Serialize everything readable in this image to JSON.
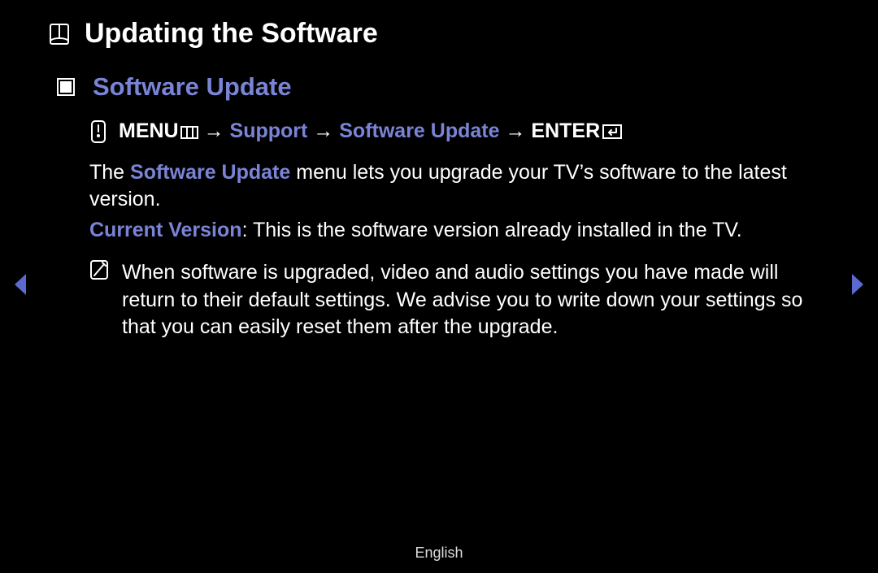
{
  "page": {
    "title": "Updating the Software"
  },
  "section": {
    "title": "Software Update"
  },
  "navPath": {
    "menu": "MENU",
    "arrow1": " → ",
    "support": "Support",
    "arrow2": " → ",
    "softwareUpdate": "Software Update",
    "arrow3": " → ",
    "enter": "ENTER"
  },
  "description": {
    "pre": "The ",
    "em": "Software Update",
    "post": " menu lets you upgrade your TV’s software to the latest version."
  },
  "currentVersion": {
    "label": "Current Version",
    "text": ": This is the software version already installed in the TV."
  },
  "note": {
    "text": "When software is upgraded, video and audio settings you have made will return to their default settings. We advise you to write down your settings so that you can easily reset them after the upgrade."
  },
  "footer": {
    "language": "English"
  }
}
